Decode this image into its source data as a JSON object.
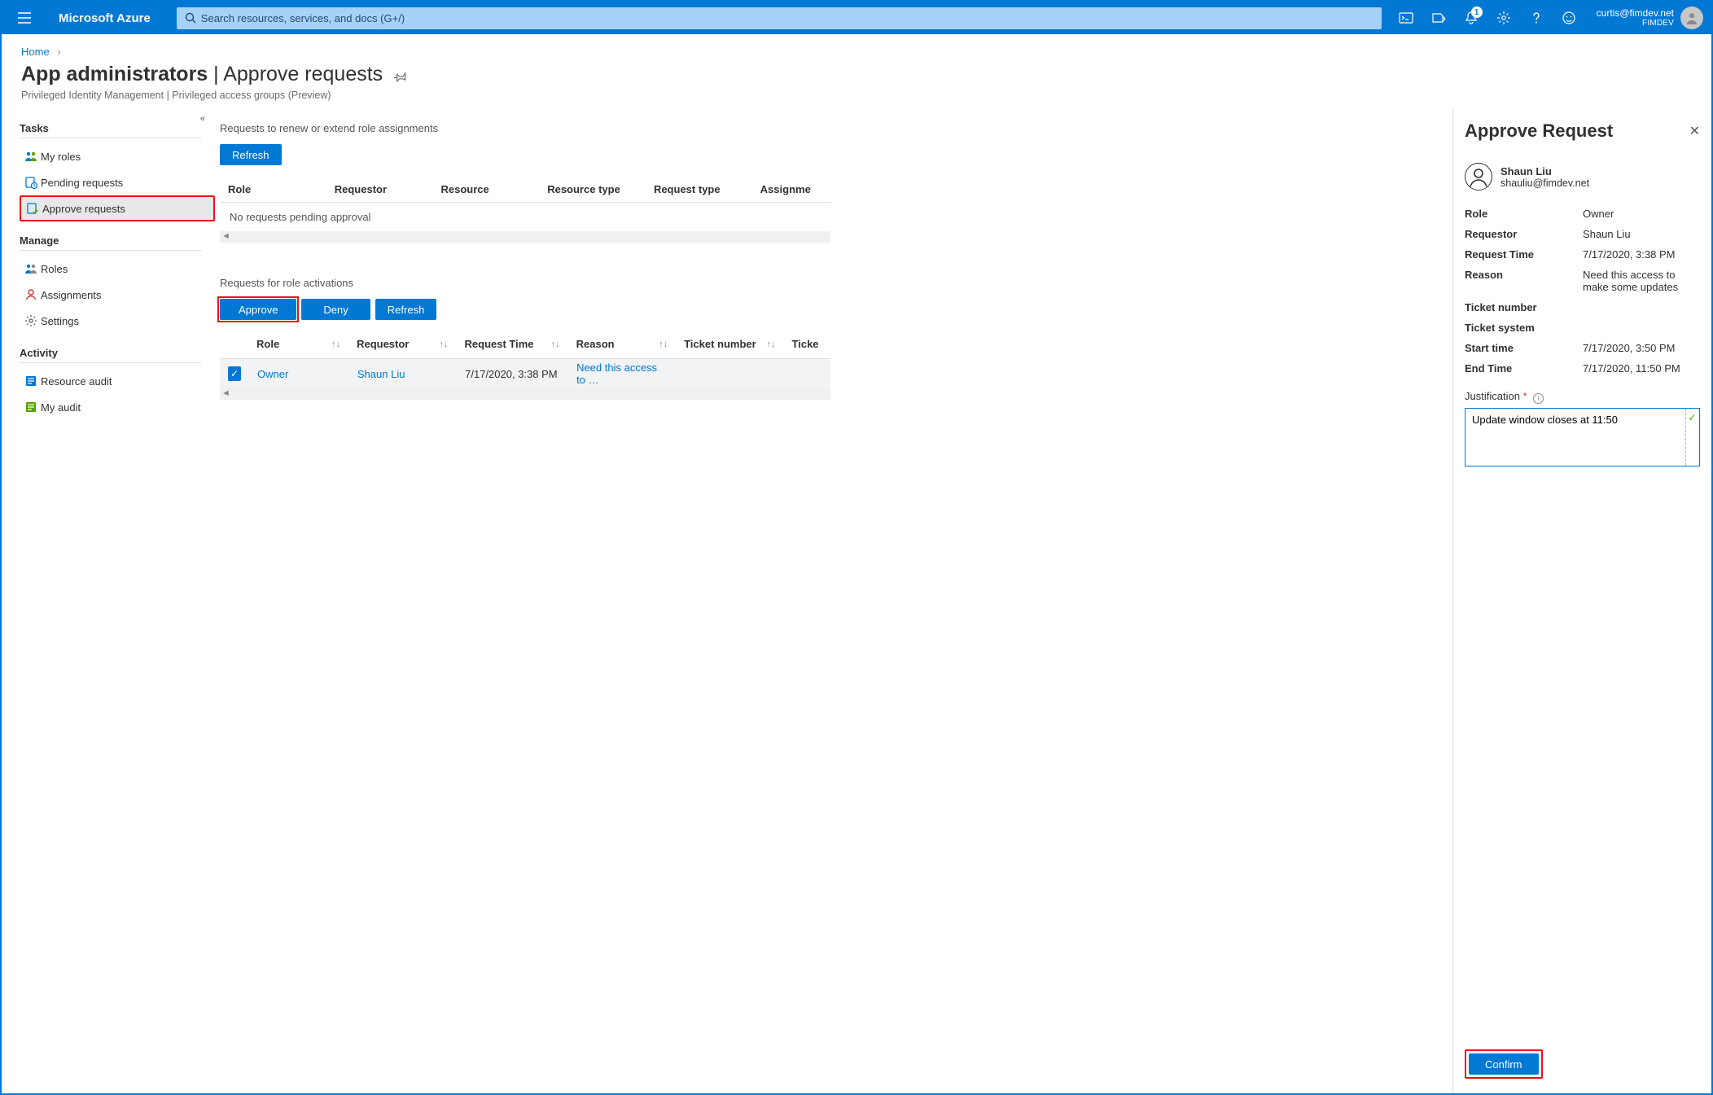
{
  "topbar": {
    "brand": "Microsoft Azure",
    "search_placeholder": "Search resources, services, and docs (G+/)",
    "notifications_badge": "1",
    "account_email": "curtis@fimdev.net",
    "account_tenant": "FIMDEV"
  },
  "breadcrumbs": {
    "home": "Home"
  },
  "header": {
    "title_strong": "App administrators",
    "title_light": "| Approve requests",
    "subtitle": "Privileged Identity Management | Privileged access groups (Preview)"
  },
  "sidebar": {
    "groups": {
      "tasks": {
        "label": "Tasks",
        "items": [
          {
            "icon": "my-roles",
            "label": "My roles"
          },
          {
            "icon": "pending",
            "label": "Pending requests"
          },
          {
            "icon": "approve",
            "label": "Approve requests",
            "selected": true,
            "callout": true
          }
        ]
      },
      "manage": {
        "label": "Manage",
        "items": [
          {
            "icon": "roles",
            "label": "Roles"
          },
          {
            "icon": "assign",
            "label": "Assignments"
          },
          {
            "icon": "settings",
            "label": "Settings"
          }
        ]
      },
      "activity": {
        "label": "Activity",
        "items": [
          {
            "icon": "res-audit",
            "label": "Resource audit"
          },
          {
            "icon": "my-audit",
            "label": "My audit"
          }
        ]
      }
    }
  },
  "section_renew": {
    "label": "Requests to renew or extend role assignments",
    "refresh": "Refresh",
    "columns": {
      "role": "Role",
      "requestor": "Requestor",
      "resource": "Resource",
      "resource_type": "Resource type",
      "request_type": "Request type",
      "assignment": "Assignme"
    },
    "empty": "No requests pending approval"
  },
  "section_activate": {
    "label": "Requests for role activations",
    "buttons": {
      "approve": "Approve",
      "deny": "Deny",
      "refresh": "Refresh"
    },
    "columns": {
      "role": "Role",
      "requestor": "Requestor",
      "request_time": "Request Time",
      "reason": "Reason",
      "ticket_number": "Ticket number",
      "ticket_system": "Ticke"
    },
    "rows": [
      {
        "checked": true,
        "role": "Owner",
        "requestor": "Shaun Liu",
        "request_time": "7/17/2020, 3:38 PM",
        "reason": "Need this access to …"
      }
    ]
  },
  "blade": {
    "title": "Approve Request",
    "person": {
      "name": "Shaun Liu",
      "email": "shauliu@fimdev.net"
    },
    "details": [
      {
        "k": "Role",
        "v": "Owner"
      },
      {
        "k": "Requestor",
        "v": "Shaun Liu"
      },
      {
        "k": "Request Time",
        "v": "7/17/2020, 3:38 PM"
      },
      {
        "k": "Reason",
        "v": "Need this access to make some updates"
      },
      {
        "k": "Ticket number",
        "v": ""
      },
      {
        "k": "Ticket system",
        "v": ""
      },
      {
        "k": "Start time",
        "v": "7/17/2020, 3:50 PM"
      },
      {
        "k": "End Time",
        "v": "7/17/2020, 11:50 PM"
      }
    ],
    "justification_label": "Justification",
    "justification_value": "Update window closes at 11:50",
    "confirm": "Confirm"
  }
}
